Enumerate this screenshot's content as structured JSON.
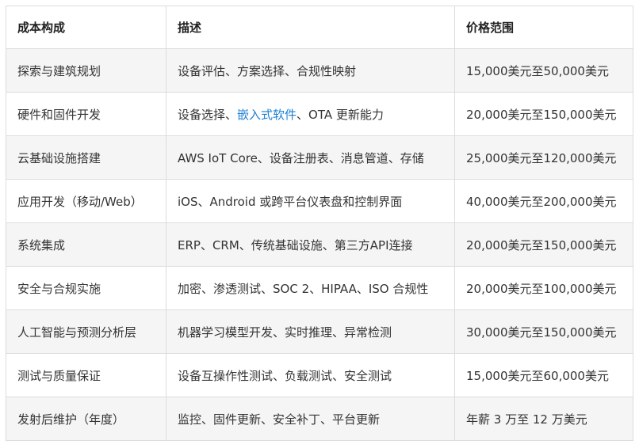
{
  "table": {
    "headers": [
      "成本构成",
      "描述",
      "价格范围"
    ],
    "rows": [
      {
        "component": "探索与建筑规划",
        "desc_pre": "设备评估、方案选择、合规性映射",
        "desc_link": "",
        "desc_post": "",
        "price": "15,000美元至50,000美元"
      },
      {
        "component": "硬件和固件开发",
        "desc_pre": "设备选择、",
        "desc_link": "嵌入式软件",
        "desc_post": "、OTA 更新能力",
        "price": "20,000美元至150,000美元"
      },
      {
        "component": "云基础设施搭建",
        "desc_pre": "AWS IoT Core、设备注册表、消息管道、存储",
        "desc_link": "",
        "desc_post": "",
        "price": "25,000美元至120,000美元"
      },
      {
        "component": "应用开发（移动/Web）",
        "desc_pre": "iOS、Android 或跨平台仪表盘和控制界面",
        "desc_link": "",
        "desc_post": "",
        "price": "40,000美元至200,000美元"
      },
      {
        "component": "系统集成",
        "desc_pre": "ERP、CRM、传统基础设施、第三方API连接",
        "desc_link": "",
        "desc_post": "",
        "price": "20,000美元至150,000美元"
      },
      {
        "component": "安全与合规实施",
        "desc_pre": "加密、渗透测试、SOC 2、HIPAA、ISO 合规性",
        "desc_link": "",
        "desc_post": "",
        "price": "20,000美元至100,000美元"
      },
      {
        "component": "人工智能与预测分析层",
        "desc_pre": "机器学习模型开发、实时推理、异常检测",
        "desc_link": "",
        "desc_post": "",
        "price": "30,000美元至150,000美元"
      },
      {
        "component": "测试与质量保证",
        "desc_pre": "设备互操作性测试、负载测试、安全测试",
        "desc_link": "",
        "desc_post": "",
        "price": "15,000美元至60,000美元"
      },
      {
        "component": "发射后维护（年度）",
        "desc_pre": "监控、固件更新、安全补丁、平台更新",
        "desc_link": "",
        "desc_post": "",
        "price": "年薪 3 万至 12 万美元"
      }
    ]
  },
  "colors": {
    "link": "#1a7fd4",
    "stripe": "#f5f5f5",
    "border": "#dcdcdc"
  }
}
